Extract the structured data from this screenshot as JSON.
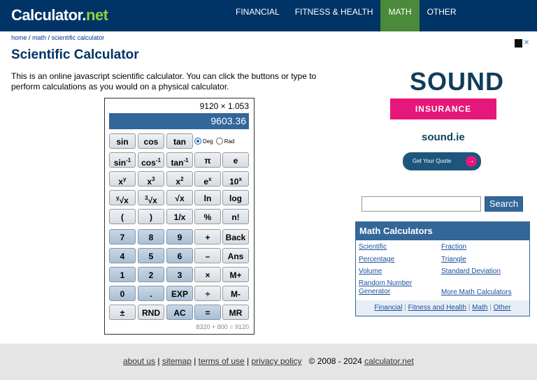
{
  "brand": {
    "name": "Calculator",
    "dot": ".",
    "tld": "net"
  },
  "nav": [
    "FINANCIAL",
    "FITNESS & HEALTH",
    "MATH",
    "OTHER"
  ],
  "breadcrumb": {
    "home": "home",
    "sep": "/",
    "math": "math",
    "page": "scientific calculator"
  },
  "page": {
    "title": "Scientific Calculator",
    "intro": "This is an online javascript scientific calculator. You can click the buttons or type to perform calculations as you would on a physical calculator."
  },
  "calculator": {
    "expression": "9120 × 1.053",
    "display": "9603.36",
    "mode": {
      "deg": "Deg",
      "rad": "Rad",
      "selected": "Deg"
    },
    "history": "8320 + 800 = 9120",
    "buttons": {
      "sin": "sin",
      "cos": "cos",
      "tan": "tan",
      "pi": "π",
      "e": "e",
      "ln": "ln",
      "log": "log",
      "lparen": "(",
      "rparen": ")",
      "recip": "1/x",
      "percent": "%",
      "fact": "n!",
      "n7": "7",
      "n8": "8",
      "n9": "9",
      "plus": "+",
      "back": "Back",
      "n4": "4",
      "n5": "5",
      "n6": "6",
      "minus": "–",
      "ans": "Ans",
      "n1": "1",
      "n2": "2",
      "n3": "3",
      "times": "×",
      "mplus": "M+",
      "n0": "0",
      "dot": ".",
      "exp": "EXP",
      "divide": "÷",
      "mminus": "M-",
      "sign": "±",
      "rnd": "RND",
      "ac": "AC",
      "equals": "=",
      "mr": "MR"
    }
  },
  "ad": {
    "headline": "SOUND",
    "tagline": "INSURANCE",
    "site": "sound.ie",
    "cta": "Get Your Quote",
    "cta_arrow": "→",
    "close": "✕"
  },
  "search": {
    "button": "Search",
    "value": ""
  },
  "math_panel": {
    "title": "Math Calculators",
    "links": [
      "Scientific",
      "Fraction",
      "Percentage",
      "Triangle",
      "Volume",
      "Standard Deviation",
      "Random Number Generator",
      "More Math Calculators"
    ],
    "footer": [
      "Financial",
      "Fitness and Health",
      "Math",
      "Other"
    ]
  },
  "footer": {
    "links": [
      "about us",
      "sitemap",
      "terms of use",
      "privacy policy"
    ],
    "copyright": "© 2008 - 2024",
    "site": "calculator.net"
  },
  "colors": {
    "header": "#003366",
    "active_nav": "#4a8a3a",
    "accent": "#336699",
    "ad_pink": "#e6177a"
  }
}
